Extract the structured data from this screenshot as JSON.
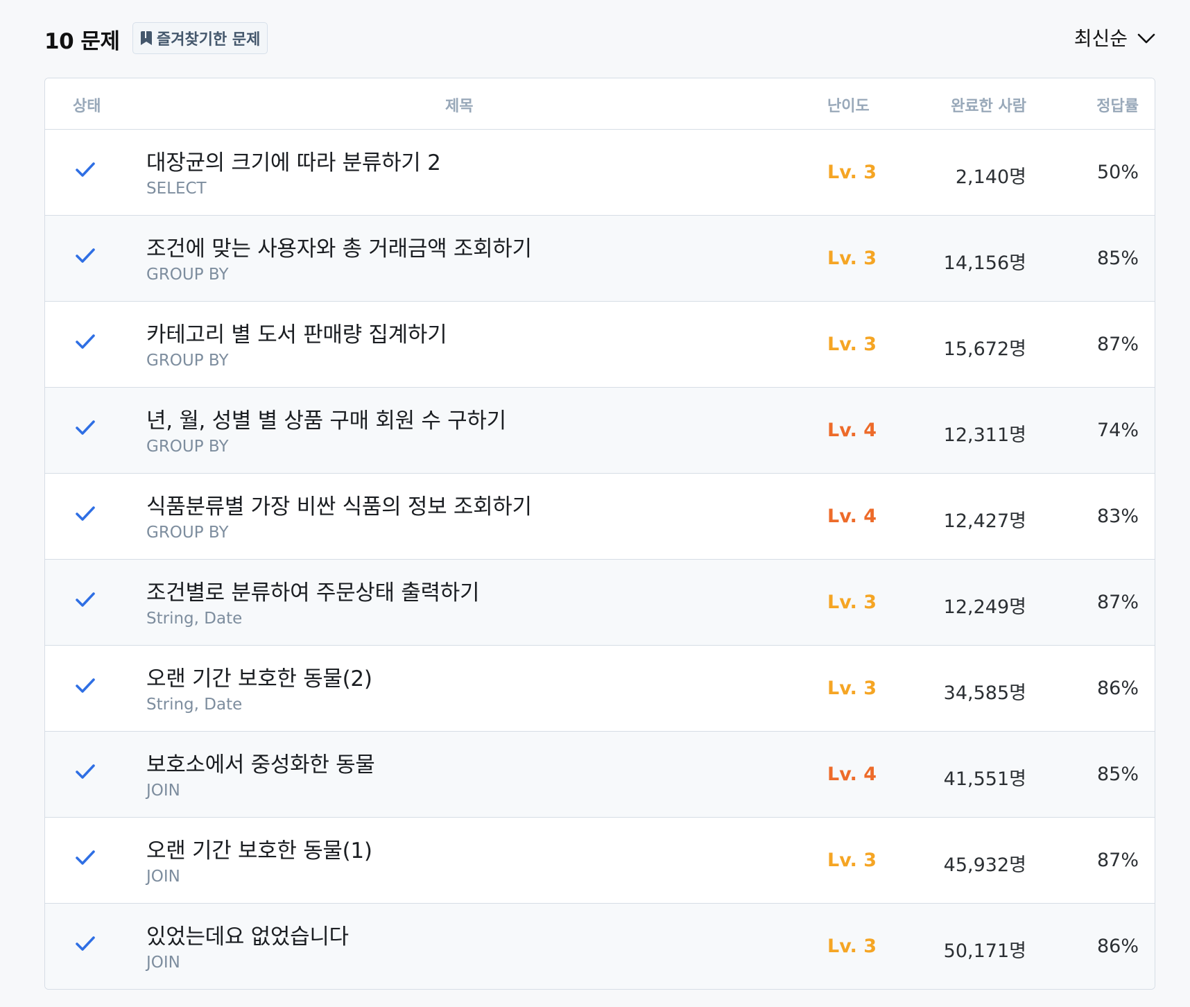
{
  "header": {
    "count_label": "10 문제",
    "favorites_label": "즐겨찾기한 문제",
    "sort_label": "최신순"
  },
  "columns": {
    "status": "상태",
    "title": "제목",
    "level": "난이도",
    "completed": "완료한 사람",
    "rate": "정답률"
  },
  "colors": {
    "check": "#2f6fe4",
    "level_3": "#f5a524",
    "level_4": "#ed6b2a"
  },
  "rows": [
    {
      "title": "대장균의 크기에 따라 분류하기 2",
      "category": "SELECT",
      "level": "Lv. 3",
      "completed": "2,140명",
      "rate": "50%",
      "solved": true
    },
    {
      "title": "조건에 맞는 사용자와 총 거래금액 조회하기",
      "category": "GROUP BY",
      "level": "Lv. 3",
      "completed": "14,156명",
      "rate": "85%",
      "solved": true
    },
    {
      "title": "카테고리 별 도서 판매량 집계하기",
      "category": "GROUP BY",
      "level": "Lv. 3",
      "completed": "15,672명",
      "rate": "87%",
      "solved": true
    },
    {
      "title": "년, 월, 성별 별 상품 구매 회원 수 구하기",
      "category": "GROUP BY",
      "level": "Lv. 4",
      "completed": "12,311명",
      "rate": "74%",
      "solved": true
    },
    {
      "title": "식품분류별 가장 비싼 식품의 정보 조회하기",
      "category": "GROUP BY",
      "level": "Lv. 4",
      "completed": "12,427명",
      "rate": "83%",
      "solved": true
    },
    {
      "title": "조건별로 분류하여 주문상태 출력하기",
      "category": "String, Date",
      "level": "Lv. 3",
      "completed": "12,249명",
      "rate": "87%",
      "solved": true
    },
    {
      "title": "오랜 기간 보호한 동물(2)",
      "category": "String, Date",
      "level": "Lv. 3",
      "completed": "34,585명",
      "rate": "86%",
      "solved": true
    },
    {
      "title": "보호소에서 중성화한 동물",
      "category": "JOIN",
      "level": "Lv. 4",
      "completed": "41,551명",
      "rate": "85%",
      "solved": true
    },
    {
      "title": "오랜 기간 보호한 동물(1)",
      "category": "JOIN",
      "level": "Lv. 3",
      "completed": "45,932명",
      "rate": "87%",
      "solved": true
    },
    {
      "title": "있었는데요 없었습니다",
      "category": "JOIN",
      "level": "Lv. 3",
      "completed": "50,171명",
      "rate": "86%",
      "solved": true
    }
  ]
}
